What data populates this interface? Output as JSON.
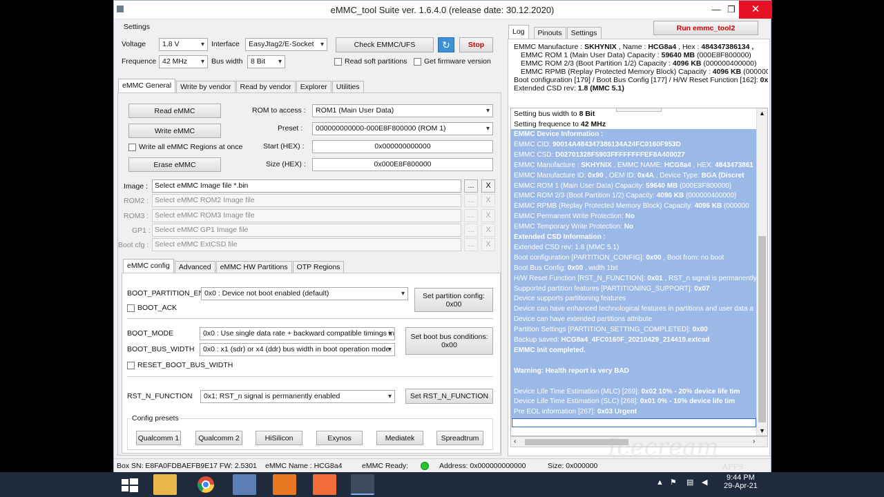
{
  "window": {
    "title": "eMMC_tool Suite  ver. 1.6.4.0 (release date: 30.12.2020)",
    "minimize": "—",
    "restore": "❐",
    "close": "✕"
  },
  "settings": {
    "group_label": "Settings",
    "voltage_label": "Voltage",
    "voltage_value": "1.8 V",
    "interface_label": "Interface",
    "interface_value": "EasyJtag2/E-Socket",
    "frequence_label": "Frequence",
    "frequence_value": "42 MHz",
    "buswidth_label": "Bus width",
    "buswidth_value": "8 Bit",
    "check_button": "Check EMMC/UFS",
    "stop_button": "Stop",
    "read_soft_partitions": "Read soft partitions",
    "get_firmware_version": "Get firmware version"
  },
  "main_tabs": [
    "eMMC General",
    "Write by vendor",
    "Read by vendor",
    "Explorer",
    "Utilities"
  ],
  "general": {
    "read_button": "Read eMMC",
    "write_button": "Write eMMC",
    "write_all_regions": "Write all eMMC Regions at once",
    "erase_button": "Erase eMMC",
    "rom_access_label": "ROM to access :",
    "rom_access_value": "ROM1 (Main User Data)",
    "preset_label": "Preset :",
    "preset_value": "000000000000-000E8F800000 (ROM 1)",
    "start_label": "Start (HEX) :",
    "start_value": "0x000000000000",
    "size_label": "Size (HEX) :",
    "size_value": "0x000E8F800000"
  },
  "images": [
    {
      "label": "Image :",
      "placeholder": "Select eMMC Image file *.bin",
      "enabled": true
    },
    {
      "label": "ROM2 :",
      "placeholder": "Select eMMC ROM2 Image file",
      "enabled": false
    },
    {
      "label": "ROM3 :",
      "placeholder": "Select eMMC ROM3 Image file",
      "enabled": false
    },
    {
      "label": "GP1 :",
      "placeholder": "Select eMMC GP1 Image file",
      "enabled": false
    },
    {
      "label": "Boot cfg :",
      "placeholder": "Select eMMC ExtCSD file",
      "enabled": false
    }
  ],
  "browse_label": "...",
  "clear_label": "X",
  "config_tabs": [
    "eMMC config",
    "Advanced",
    "eMMC HW Partitions",
    "OTP Regions"
  ],
  "config": {
    "boot_partition_label": "BOOT_PARTITION_EN",
    "boot_partition_value": "0x0 : Device not boot enabled (default)",
    "boot_ack": "BOOT_ACK",
    "set_partition_button": "Set partition config:\n0x00",
    "boot_mode_label": "BOOT_MODE",
    "boot_mode_value": "0x0 : Use single data rate + backward compatible timings in boot operation",
    "boot_bus_width_label": "BOOT_BUS_WIDTH",
    "boot_bus_width_value": "0x0 : x1 (sdr) or x4 (ddr) bus width in boot operation mode",
    "set_boot_bus_button": "Set boot bus conditions:\n0x00",
    "reset_boot_bus_width": "RESET_BOOT_BUS_WIDTH",
    "rst_label": "RST_N_FUNCTION",
    "rst_value": "0x1: RST_n signal is permanently enabled",
    "set_rst_button": "Set RST_N_FUNCTION",
    "presets_label": "Config presets",
    "presets": [
      "Qualcomm 1",
      "Qualcomm 2",
      "HiSilicon",
      "Exynos",
      "Mediatek",
      "Spreadtrum"
    ]
  },
  "right_tabs": [
    "Log",
    "Pinouts",
    "Settings"
  ],
  "run_button": "Run emmc_tool2",
  "info": [
    {
      "a": "EMMC Manufacture : ",
      "b": "SKHYNIX",
      "c": " , Name : ",
      "d": "HCG8a4",
      "e": " , Hex : ",
      "f": "484347386134 ,",
      "indent": false
    },
    {
      "a": "EMMC ROM 1 (Main User Data) Capacity : ",
      "b": "59640 MB",
      "c": " (000E8F800000)",
      "indent": true
    },
    {
      "a": "EMMC ROM 2/3 (Boot Partition 1/2) Capacity : ",
      "b": "4096 KB",
      "c": " (000000400000)",
      "indent": true
    },
    {
      "a": "EMMC RPMB (Replay Protected Memory Block) Capacity : ",
      "b": "4096 KB",
      "c": " (0000004000",
      "indent": true
    },
    {
      "a": "Boot configuration [179] / Boot Bus Config [177] / H/W Reset Function [162]: ",
      "b": "0x",
      "c": "",
      "indent": false
    },
    {
      "a": "Extended CSD rev: ",
      "b": "1.8 (MMC 5.1)",
      "c": "",
      "indent": false
    }
  ],
  "log_top": [
    {
      "a": "Setting bus width to ",
      "b": "8 Bit"
    },
    {
      "a": "Setting frequence to ",
      "b": "42 MHz"
    }
  ],
  "log_selected": [
    {
      "a": "",
      "b": "EMMC Device Information :"
    },
    {
      "a": "EMMC CID: ",
      "b": "90014A484347386134A24FC0160F953D"
    },
    {
      "a": "EMMC CSD: ",
      "b": "D02701328F5903FFFFFFFFEF8A400027"
    },
    {
      "a": "EMMC Manufacture : ",
      "b": "SKHYNIX",
      "c": " , EMMC NAME: ",
      "d": "HCG8a4",
      "e": " , HEX: ",
      "f": "4843473861"
    },
    {
      "a": "EMMC Manufacture ID: ",
      "b": "0x90",
      "c": " , OEM ID: ",
      "d": "0x4A",
      "e": " , Device Type: ",
      "f": "BGA (Discret"
    },
    {
      "a": "   EMMC ROM 1 (Main User Data) Capacity: ",
      "b": "59640 MB",
      "c": " (000E8F800000)"
    },
    {
      "a": "   EMMC ROM 2/3 (Boot Partition 1/2) Capacity: ",
      "b": "4096 KB",
      "c": " (000000400000)"
    },
    {
      "a": "   EMMC RPMB (Replay Protected Memory Block) Capacity: ",
      "b": "4096 KB",
      "c": " (000000"
    },
    {
      "a": "EMMC Permanent Write Protection: ",
      "b": "No"
    },
    {
      "a": "EMMC Temporary Write Protection: ",
      "b": "No"
    },
    {
      "a": "",
      "b": "Extended CSD Information :"
    },
    {
      "a": "Extended CSD rev: 1.8 (MMC 5.1)",
      "b": ""
    },
    {
      "a": "Boot configuration [PARTITION_CONFIG]: ",
      "b": "0x00",
      "c": " , Boot from: no boot"
    },
    {
      "a": "Boot Bus Config: ",
      "b": "0x00",
      "c": " , width 1bit"
    },
    {
      "a": "H/W Reset Function [RST_N_FUNCTION]: ",
      "b": "0x01",
      "c": " , RST_n signal is permanently"
    },
    {
      "a": "Supported partition features [PARTITIONING_SUPPORT]: ",
      "b": "0x07"
    },
    {
      "a": "Device supports partitioning features",
      "b": ""
    },
    {
      "a": "Device can have enhanced technological features in partitions and user data a",
      "b": ""
    },
    {
      "a": "Device can have extended partitions attribute",
      "b": ""
    },
    {
      "a": "Partition Settings [PARTITION_SETTING_COMPLETED]: ",
      "b": "0x00"
    },
    {
      "a": "Backup saved: ",
      "b": "HCG8a4_4FC0160F_20210429_214419.extcsd"
    },
    {
      "a": "",
      "b": "EMMC Init completed."
    },
    {
      "a": "",
      "b": ""
    },
    {
      "a": "",
      "b": "Warning: Health report is very BAD"
    },
    {
      "a": "",
      "b": ""
    },
    {
      "a": "Device Life Time Estimation (MLC) [269]: ",
      "b": "0x02",
      "c": "   ",
      "d": "10% - 20% device life tim"
    },
    {
      "a": "Device Life Time Estimation (SLC) [268]: ",
      "b": "0x01",
      "c": "   ",
      "d": "0% - 10% device life tim"
    },
    {
      "a": "Pre EOL information [267]: ",
      "b": "0x03",
      "c": "   ",
      "d": "Urgent"
    }
  ],
  "status": {
    "box_sn": "Box SN:  E8FA0FDBAEFB9E17  FW:  2.5301",
    "emmc_name": "eMMC Name : HCG8a4",
    "emmc_ready": "eMMC Ready:",
    "address": "Address: 0x000000000000",
    "size": "Size: 0x000000"
  },
  "watermark": "Icecream",
  "watermark_sub": "APPS",
  "taskbar": {
    "time": "9:44 PM",
    "date": "29-Apr-21"
  }
}
